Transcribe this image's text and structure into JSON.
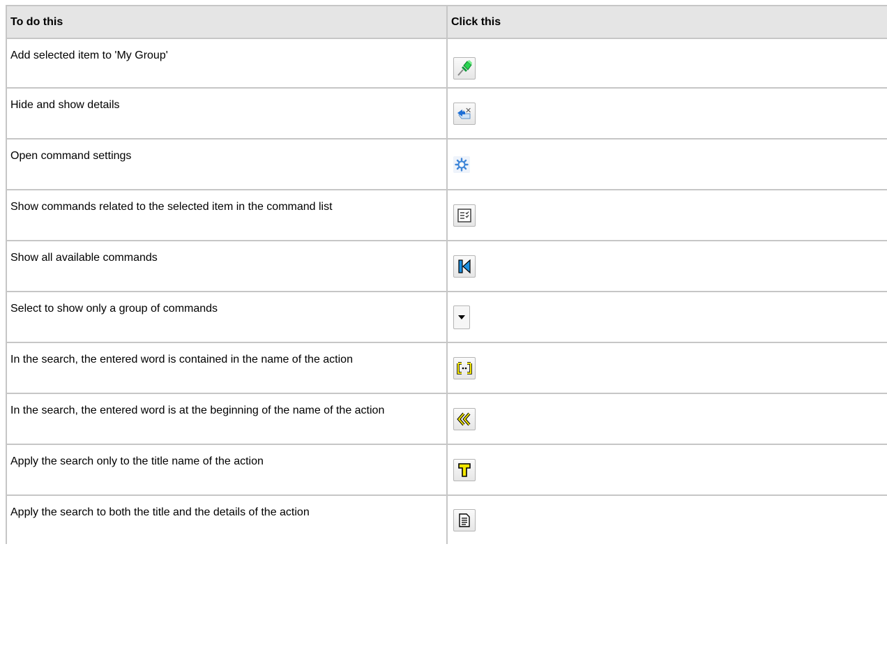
{
  "header": {
    "col1": "To do this",
    "col2": "Click this"
  },
  "rows": [
    {
      "action": "Add selected item to 'My Group'",
      "icon": "pin-icon"
    },
    {
      "action": "Hide and show details",
      "icon": "hide-details-icon"
    },
    {
      "action": "Open command settings",
      "icon": "gear-icon"
    },
    {
      "action": "Show commands related to the selected item in the command list",
      "icon": "related-commands-icon"
    },
    {
      "action": "Show all available commands",
      "icon": "show-all-icon"
    },
    {
      "action": "Select to show only a group of commands",
      "icon": "dropdown-arrow-icon"
    },
    {
      "action": "In the search, the entered word is contained in the name of the action",
      "icon": "contains-icon"
    },
    {
      "action": "In the search, the entered word is at the beginning of the name of the action",
      "icon": "begins-with-icon"
    },
    {
      "action": "Apply the search only to the title name of the action",
      "icon": "title-only-icon"
    },
    {
      "action": "Apply the search to both the title and the details of the action",
      "icon": "title-and-details-icon"
    }
  ],
  "colors": {
    "border": "#c6c6c6",
    "header_bg": "#e5e5e5",
    "accent_yellow": "#f2e600",
    "accent_blue": "#1b8fe0"
  }
}
